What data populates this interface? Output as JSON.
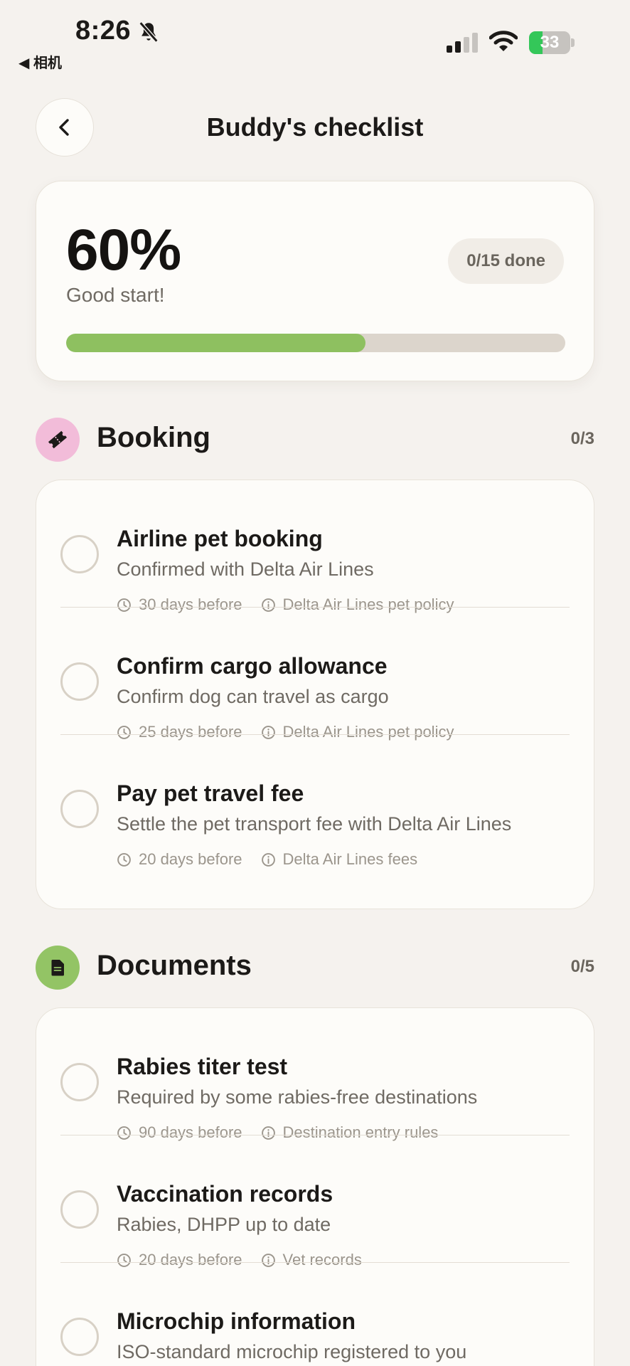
{
  "status_bar": {
    "time": "8:26",
    "back_app": "◀ 相机",
    "battery": "33",
    "battery_level": 0.33
  },
  "header": {
    "title": "Buddy's checklist"
  },
  "progress": {
    "percent_label": "60%",
    "message": "Good start!",
    "done_label": "0/15 done",
    "fill_fraction": 0.6,
    "fill_color": "#8ec060"
  },
  "sections": [
    {
      "title": "Booking",
      "count": "0/3",
      "icon": "ticket-icon",
      "icon_bg": "#f2bcd9",
      "items": [
        {
          "title": "Airline pet booking",
          "desc": "Confirmed with Delta Air Lines",
          "timing": "30 days before",
          "source": "Delta Air Lines pet policy"
        },
        {
          "title": "Confirm cargo allowance",
          "desc": "Confirm dog can travel as cargo",
          "timing": "25 days before",
          "source": "Delta Air Lines pet policy"
        },
        {
          "title": "Pay pet travel fee",
          "desc": "Settle the pet transport fee with Delta Air Lines",
          "timing": "20 days before",
          "source": "Delta Air Lines fees"
        }
      ]
    },
    {
      "title": "Documents",
      "count": "0/5",
      "icon": "document-icon",
      "icon_bg": "#93c465",
      "items": [
        {
          "title": "Rabies titer test",
          "desc": "Required by some rabies-free destinations",
          "timing": "90 days before",
          "source": "Destination entry rules"
        },
        {
          "title": "Vaccination records",
          "desc": "Rabies, DHPP up to date",
          "timing": "20 days before",
          "source": "Vet records"
        },
        {
          "title": "Microchip information",
          "desc": "ISO-standard microchip registered to you"
        }
      ]
    }
  ]
}
